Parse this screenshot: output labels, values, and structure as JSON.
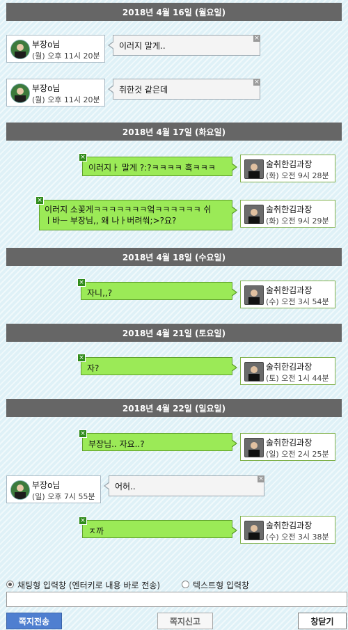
{
  "date_headers": [
    "2018년 4월 16일 (월요일)",
    "2018년 4월 17일 (화요일)",
    "2018년 4월 18일 (수요일)",
    "2018년 4월 21일 (토요일)",
    "2018년 4월 22일 (일요일)"
  ],
  "messages": [
    {
      "sender": "부장o님",
      "time": "(월) 오후 11시 20분",
      "text": "이러지 말게..",
      "side": "other"
    },
    {
      "sender": "부장o님",
      "time": "(월) 오후 11시 20분",
      "text": "취한것 같은데",
      "side": "other"
    },
    {
      "sender": "술취한김과장",
      "time": "(화) 오전 9시 28분",
      "text": "이러지ㅏ 말게 ?:?ㅋㅋㅋㅋ 흑ㅋㅋㅋ",
      "side": "me"
    },
    {
      "sender": "술취한김과장",
      "time": "(화) 오전 9시 29분",
      "text_line1": "이러지 소꽃게ㅋㅋㅋㅋㅋㅋㅋ엌ㅋㅋㅋㅋㅋㅋ 쉬",
      "text_line2": "ㅣ바ㅡ 부장님,, 왜 나ㅏ버려쒀;>?요?",
      "side": "me"
    },
    {
      "sender": "술취한김과장",
      "time": "(수) 오전 3시 54분",
      "text": "자니,,?",
      "side": "me"
    },
    {
      "sender": "술취한김과장",
      "time": "(토) 오전 1시 44분",
      "text": "자?",
      "side": "me"
    },
    {
      "sender": "술취한김과장",
      "time": "(일) 오전 2시 25분",
      "text": "부장님.. 자요..?",
      "side": "me"
    },
    {
      "sender": "부장o님",
      "time": "(일) 오후 7시 55분",
      "text": "어허..",
      "side": "other"
    },
    {
      "sender": "술취한김과장",
      "time": "(수) 오전 3시 38분",
      "text": "ㅈ까",
      "side": "me"
    }
  ],
  "input_mode": {
    "chat_label": "채팅형 입력창 (엔터키로 내용 바로 전송)",
    "text_label": "텍스트형 입력창",
    "selected": "chat"
  },
  "buttons": {
    "send": "쪽지전송",
    "report": "쪽지신고",
    "close": "창닫기"
  },
  "icons": {
    "delete_other": "close-gray-icon",
    "delete_me": "close-green-icon",
    "avatar": "profile-photo"
  },
  "colors": {
    "date_bar": "#666666",
    "my_bubble": "#9bea57",
    "other_bubble": "#f4f4f4",
    "send_button": "#4f7fd0"
  }
}
